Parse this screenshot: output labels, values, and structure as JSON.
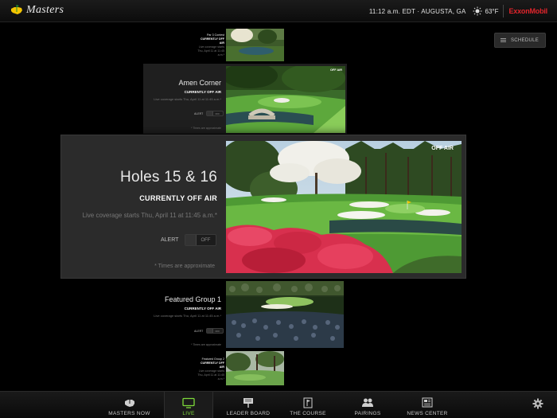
{
  "header": {
    "logo_text": "Masters",
    "clock": "11:12 a.m. EDT · AUGUSTA, GA",
    "temperature": "63°F",
    "sponsor": "ExxonMobil"
  },
  "schedule_button": {
    "label": "SCHEDULE"
  },
  "cards": [
    {
      "title": "Par 3 Contest",
      "status": "CURRENTLY OFF AIR",
      "desc": "Live coverage starts Thu, April 11 at 11:45 a.m.*",
      "alert_label": "ALERT",
      "toggle": "OFF",
      "off_badge": "",
      "note": "* Times are approximate"
    },
    {
      "title": "Amen Corner",
      "status": "CURRENTLY OFF AIR",
      "desc": "Live coverage starts Thu, April 11 at 11:45 a.m.*",
      "alert_label": "ALERT",
      "toggle": "OFF",
      "off_badge": "OFF AIR",
      "note": "* Times are approximate"
    },
    {
      "title": "Holes 15 & 16",
      "status": "CURRENTLY OFF AIR",
      "desc": "Live coverage starts Thu, April 11 at 11:45 a.m.*",
      "alert_label": "ALERT",
      "toggle": "OFF",
      "off_badge": "OFF AIR",
      "note": "* Times are approximate"
    },
    {
      "title": "Featured Group 1",
      "status": "CURRENTLY OFF AIR",
      "desc": "Live coverage starts Thu, April 11 at 11:45 a.m.*",
      "alert_label": "ALERT",
      "toggle": "OFF",
      "off_badge": "",
      "note": "* Times are approximate"
    },
    {
      "title": "Featured Group 2",
      "status": "CURRENTLY OFF AIR",
      "desc": "Live coverage starts Thu, April 11 at 11:45 a.m.*",
      "alert_label": "ALERT",
      "toggle": "OFF",
      "off_badge": "",
      "note": "* Times are approximate"
    }
  ],
  "nav": [
    {
      "label": "MASTERS NOW",
      "icon": "masters-now-icon"
    },
    {
      "label": "LIVE",
      "icon": "tv-icon",
      "active": true
    },
    {
      "label": "LEADER BOARD",
      "icon": "leader-board-icon"
    },
    {
      "label": "THE COURSE",
      "icon": "flag-icon"
    },
    {
      "label": "PAIRINGS",
      "icon": "pairings-icon"
    },
    {
      "label": "NEWS CENTER",
      "icon": "news-icon"
    }
  ],
  "colors": {
    "accent": "#7dd93a",
    "sponsor_red": "#e0242b",
    "card_bg": "#2b2b2b"
  }
}
